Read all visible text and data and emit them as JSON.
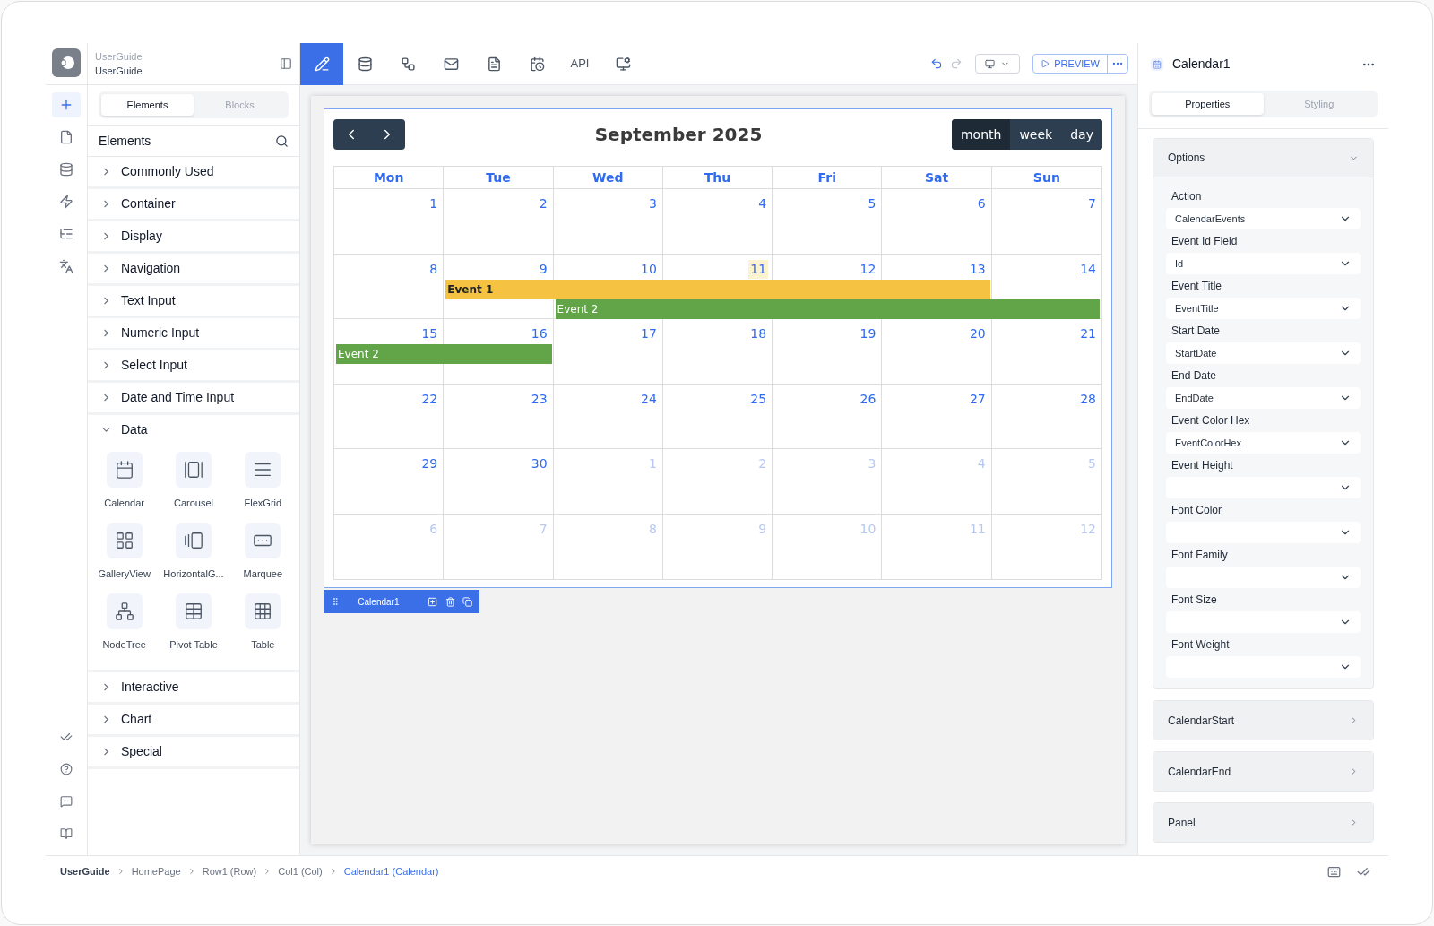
{
  "app": {
    "workspace": "UserGuide",
    "project": "UserGuide"
  },
  "rail": {
    "top": [
      {
        "selected": true
      },
      {
        "selected": false
      },
      {
        "selected": false
      },
      {
        "selected": false
      },
      {
        "selected": false
      },
      {
        "selected": false
      }
    ]
  },
  "left_panel": {
    "tabs": [
      {
        "label": "Elements",
        "selected": true
      },
      {
        "label": "Blocks",
        "selected": false
      }
    ],
    "title": "Elements",
    "categories": [
      {
        "label": "Commonly Used",
        "expanded": false
      },
      {
        "label": "Container",
        "expanded": false
      },
      {
        "label": "Display",
        "expanded": false
      },
      {
        "label": "Navigation",
        "expanded": false
      },
      {
        "label": "Text Input",
        "expanded": false
      },
      {
        "label": "Numeric Input",
        "expanded": false
      },
      {
        "label": "Select Input",
        "expanded": false
      },
      {
        "label": "Date and Time Input",
        "expanded": false
      },
      {
        "label": "Data",
        "expanded": true,
        "items": [
          "Calendar",
          "Carousel",
          "FlexGrid",
          "GalleryView",
          "HorizontalG...",
          "Marquee",
          "NodeTree",
          "Pivot Table",
          "Table"
        ]
      },
      {
        "label": "Interactive",
        "expanded": false
      },
      {
        "label": "Chart",
        "expanded": false
      },
      {
        "label": "Special",
        "expanded": false
      }
    ]
  },
  "toolbar": {
    "tabs": [
      {
        "selected": true
      },
      {
        "selected": false
      },
      {
        "selected": false
      },
      {
        "selected": false
      },
      {
        "selected": false
      },
      {
        "selected": false
      },
      {
        "label": "API",
        "selected": false
      },
      {
        "selected": false
      }
    ],
    "preview": "PREVIEW"
  },
  "calendar": {
    "title": "September 2025",
    "views": [
      {
        "label": "month",
        "selected": true
      },
      {
        "label": "week",
        "selected": false
      },
      {
        "label": "day",
        "selected": false
      }
    ],
    "weekdays": [
      "Mon",
      "Tue",
      "Wed",
      "Thu",
      "Fri",
      "Sat",
      "Sun"
    ],
    "weeks": [
      {
        "days": [
          {
            "label": "1",
            "in_month": true,
            "today": false
          },
          {
            "label": "2",
            "in_month": true,
            "today": false
          },
          {
            "label": "3",
            "in_month": true,
            "today": false
          },
          {
            "label": "4",
            "in_month": true,
            "today": false
          },
          {
            "label": "5",
            "in_month": true,
            "today": false
          },
          {
            "label": "6",
            "in_month": true,
            "today": false
          },
          {
            "label": "7",
            "in_month": true,
            "today": false
          }
        ]
      },
      {
        "days": [
          {
            "label": "8",
            "in_month": true,
            "today": false
          },
          {
            "label": "9",
            "in_month": true,
            "today": false
          },
          {
            "label": "10",
            "in_month": true,
            "today": false
          },
          {
            "label": "11",
            "in_month": true,
            "today": true
          },
          {
            "label": "12",
            "in_month": true,
            "today": false
          },
          {
            "label": "13",
            "in_month": true,
            "today": false
          },
          {
            "label": "14",
            "in_month": true,
            "today": false
          }
        ],
        "events": [
          {
            "title": "Event 1",
            "color": "#f5c242",
            "days": [
              false,
              true,
              true,
              true,
              true,
              true,
              false
            ]
          },
          {
            "title": "Event 2",
            "color": "#62a548",
            "days": [
              false,
              false,
              true,
              true,
              true,
              true,
              true
            ]
          }
        ]
      },
      {
        "days": [
          {
            "label": "15",
            "in_month": true,
            "today": false
          },
          {
            "label": "16",
            "in_month": true,
            "today": false
          },
          {
            "label": "17",
            "in_month": true,
            "today": false
          },
          {
            "label": "18",
            "in_month": true,
            "today": false
          },
          {
            "label": "19",
            "in_month": true,
            "today": false
          },
          {
            "label": "20",
            "in_month": true,
            "today": false
          },
          {
            "label": "21",
            "in_month": true,
            "today": false
          }
        ],
        "events": [
          {
            "title": "Event 2",
            "color": "#62a548",
            "days": [
              true,
              true,
              false,
              false,
              false,
              false,
              false
            ]
          }
        ]
      },
      {
        "days": [
          {
            "label": "22",
            "in_month": true,
            "today": false
          },
          {
            "label": "23",
            "in_month": true,
            "today": false
          },
          {
            "label": "24",
            "in_month": true,
            "today": false
          },
          {
            "label": "25",
            "in_month": true,
            "today": false
          },
          {
            "label": "26",
            "in_month": true,
            "today": false
          },
          {
            "label": "27",
            "in_month": true,
            "today": false
          },
          {
            "label": "28",
            "in_month": true,
            "today": false
          }
        ]
      },
      {
        "days": [
          {
            "label": "29",
            "in_month": true,
            "today": false
          },
          {
            "label": "30",
            "in_month": true,
            "today": false
          },
          {
            "label": "1",
            "in_month": false,
            "today": false
          },
          {
            "label": "2",
            "in_month": false,
            "today": false
          },
          {
            "label": "3",
            "in_month": false,
            "today": false
          },
          {
            "label": "4",
            "in_month": false,
            "today": false
          },
          {
            "label": "5",
            "in_month": false,
            "today": false
          }
        ]
      },
      {
        "days": [
          {
            "label": "6",
            "in_month": false,
            "today": false
          },
          {
            "label": "7",
            "in_month": false,
            "today": false
          },
          {
            "label": "8",
            "in_month": false,
            "today": false
          },
          {
            "label": "9",
            "in_month": false,
            "today": false
          },
          {
            "label": "10",
            "in_month": false,
            "today": false
          },
          {
            "label": "11",
            "in_month": false,
            "today": false
          },
          {
            "label": "12",
            "in_month": false,
            "today": false
          }
        ]
      }
    ]
  },
  "component_bar": {
    "label": "Calendar1"
  },
  "right_panel": {
    "title": "Calendar1",
    "tabs": [
      {
        "label": "Properties",
        "selected": true
      },
      {
        "label": "Styling",
        "selected": false
      }
    ],
    "sections": [
      {
        "label": "Options",
        "expanded": true,
        "fields": [
          {
            "label": "Action",
            "value": "CalendarEvents"
          },
          {
            "label": "Event Id Field",
            "value": "Id"
          },
          {
            "label": "Event Title",
            "value": "EventTitle"
          },
          {
            "label": "Start Date",
            "value": "StartDate"
          },
          {
            "label": "End Date",
            "value": "EndDate"
          },
          {
            "label": "Event Color Hex",
            "value": "EventColorHex"
          },
          {
            "label": "Event Height"
          },
          {
            "label": "Font Color"
          },
          {
            "label": "Font Family"
          },
          {
            "label": "Font Size"
          },
          {
            "label": "Font Weight"
          }
        ]
      },
      {
        "label": "CalendarStart",
        "expanded": false
      },
      {
        "label": "CalendarEnd",
        "expanded": false
      },
      {
        "label": "Panel",
        "expanded": false
      }
    ]
  },
  "breadcrumb": [
    {
      "label": "UserGuide",
      "selected": false,
      "kind": "root"
    },
    {
      "label": "HomePage",
      "selected": false,
      "kind": "page"
    },
    {
      "label": "Row1 (Row)",
      "selected": false,
      "kind": "page"
    },
    {
      "label": "Col1 (Col)",
      "selected": false,
      "kind": "page"
    },
    {
      "label": "Calendar1 (Calendar)",
      "selected": true,
      "kind": "page"
    }
  ]
}
